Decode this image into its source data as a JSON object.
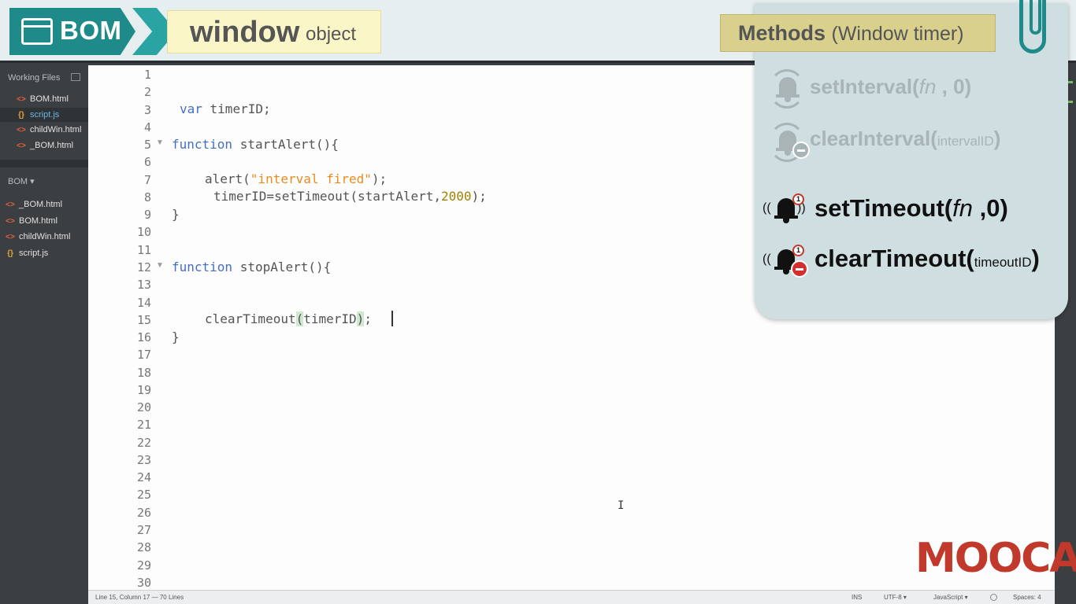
{
  "header": {
    "bom_label": "BOM",
    "window_title": "window",
    "window_subtitle": "object"
  },
  "sidebar": {
    "working_files_label": "Working Files",
    "working_files": [
      {
        "name": "BOM.html",
        "type": "html",
        "active": false
      },
      {
        "name": "script.js",
        "type": "js",
        "active": true
      },
      {
        "name": "childWin.html",
        "type": "html",
        "active": false
      },
      {
        "name": "_BOM.html",
        "type": "html",
        "active": false
      }
    ],
    "project_label": "BOM ▾",
    "project_files": [
      {
        "name": "_BOM.html",
        "type": "html"
      },
      {
        "name": "BOM.html",
        "type": "html"
      },
      {
        "name": "childWin.html",
        "type": "html"
      },
      {
        "name": "script.js",
        "type": "js"
      }
    ],
    "html_icon": "<>",
    "js_icon": "{}"
  },
  "editor": {
    "line_numbers": [
      "1",
      "2",
      "3",
      "4",
      "5",
      "6",
      "7",
      "8",
      "9",
      "10",
      "11",
      "12",
      "13",
      "14",
      "15",
      "16",
      "17",
      "18",
      "19",
      "20",
      "21",
      "22",
      "23",
      "24",
      "25",
      "26",
      "27",
      "28",
      "29",
      "30"
    ],
    "code": {
      "l3_kw": "var",
      "l3_rest": " timerID;",
      "l5_kw": "function",
      "l5_rest": " startAlert(){",
      "l7_a": "alert(",
      "l7_str": "\"interval fired\"",
      "l7_b": ");",
      "l8_a": "timerID=setTimeout(startAlert,",
      "l8_num": "2000",
      "l8_b": ");",
      "l9": "}",
      "l12_kw": "function",
      "l12_rest": " stopAlert(){",
      "l15_a": "clearTimeout",
      "l15_open": "(",
      "l15_b": "timerID",
      "l15_close": ")",
      "l15_c": ";",
      "l16": "}"
    }
  },
  "status_bar": {
    "position": "Line 15, Column 17 — 70 Lines",
    "ins": "INS",
    "encoding": "UTF-8 ▾",
    "language": "JavaScript ▾",
    "spaces": "Spaces: 4"
  },
  "methods": {
    "title": "Methods",
    "subtitle": "(Window timer)",
    "items": [
      {
        "name": "setInterval(",
        "arg": "fn",
        "rest": " , 0)",
        "dim": true
      },
      {
        "name": "clearInterval(",
        "arg_small": "intervalID",
        "rest": ")",
        "dim": true
      },
      {
        "name": "setTimeout(",
        "arg": "fn",
        "rest": " ,0)",
        "dim": false
      },
      {
        "name": "clearTimeout(",
        "arg_small": "timeoutID",
        "rest": ")",
        "dim": false
      }
    ],
    "badge": "1"
  },
  "logo": {
    "text": "MOOCA"
  },
  "colors": {
    "teal": "#1f8a8a",
    "keyword": "#446fbd",
    "string": "#e88c1e",
    "logo_red": "#c0392b"
  }
}
